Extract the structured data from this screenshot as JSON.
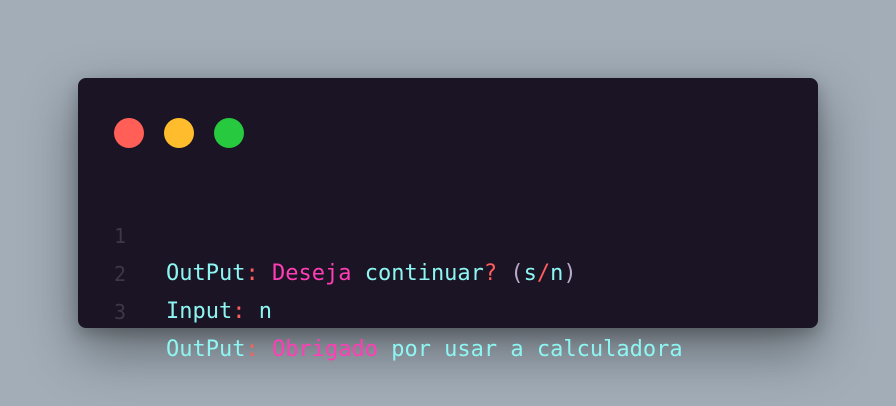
{
  "colors": {
    "background": "#a2adb8",
    "window": "#1b1424",
    "dot_red": "#ff5f56",
    "dot_yellow": "#ffbd2e",
    "dot_green": "#27c93f",
    "line_number": "#3d3747",
    "identifier": "#8ef6f2",
    "punctuation": "#ff5e5e",
    "keyword": "#ff3eb5",
    "paren": "#b8a9c9"
  },
  "window_controls": [
    "close-dot",
    "minimize-dot",
    "maximize-dot"
  ],
  "lines": [
    {
      "number": "1",
      "tokens": [
        {
          "text": "OutPut",
          "type": "identifier"
        },
        {
          "text": ":",
          "type": "punctuation"
        },
        {
          "text": " ",
          "type": "identifier"
        },
        {
          "text": "Deseja",
          "type": "keyword"
        },
        {
          "text": " continuar",
          "type": "identifier"
        },
        {
          "text": "?",
          "type": "punctuation"
        },
        {
          "text": " ",
          "type": "identifier"
        },
        {
          "text": "(",
          "type": "paren"
        },
        {
          "text": "s",
          "type": "identifier"
        },
        {
          "text": "/",
          "type": "punctuation"
        },
        {
          "text": "n",
          "type": "identifier"
        },
        {
          "text": ")",
          "type": "paren"
        }
      ]
    },
    {
      "number": "2",
      "tokens": [
        {
          "text": "Input",
          "type": "identifier"
        },
        {
          "text": ":",
          "type": "punctuation"
        },
        {
          "text": " n",
          "type": "identifier"
        }
      ]
    },
    {
      "number": "3",
      "tokens": [
        {
          "text": "OutPut",
          "type": "identifier"
        },
        {
          "text": ":",
          "type": "punctuation"
        },
        {
          "text": " ",
          "type": "identifier"
        },
        {
          "text": "Obrigado",
          "type": "keyword"
        },
        {
          "text": " por usar a calculadora",
          "type": "identifier"
        }
      ]
    }
  ]
}
